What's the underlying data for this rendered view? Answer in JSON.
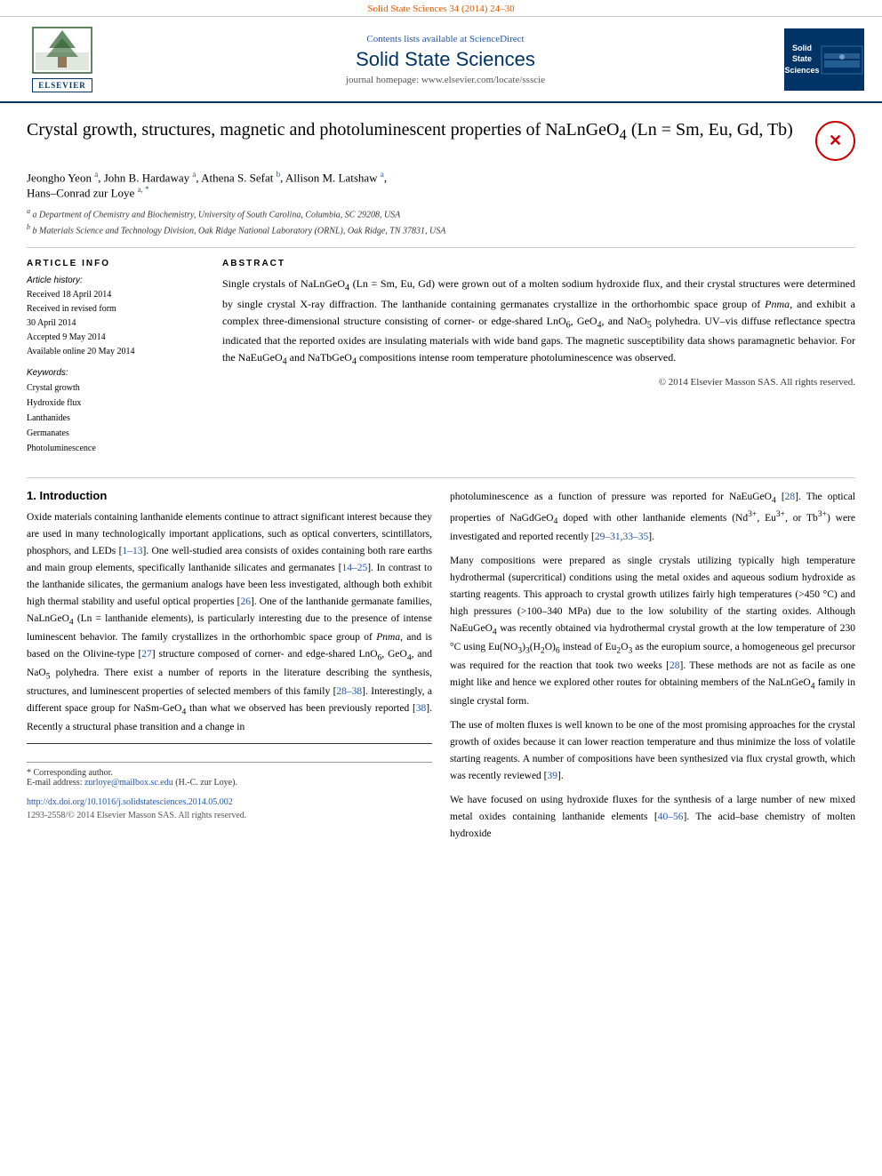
{
  "topbar": {
    "text": "Solid State Sciences 34 (2014) 24–30"
  },
  "header": {
    "contents_text": "Contents lists available at",
    "contents_link": "ScienceDirect",
    "journal_title": "Solid State Sciences",
    "homepage_label": "journal homepage: www.elsevier.com/locate/ssscie",
    "logo_left_label": "ELSEVIER",
    "logo_right_text": "Solid\nState\nSciences"
  },
  "article": {
    "title": "Crystal growth, structures, magnetic and photoluminescent properties of NaLnGeO₄ (Ln = Sm, Eu, Gd, Tb)",
    "authors": "Jeongho Yeon a, John B. Hardaway a, Athena S. Sefat b, Allison M. Latshaw a, Hans–Conrad zur Loye a, *",
    "affiliation_a": "a Department of Chemistry and Biochemistry, University of South Carolina, Columbia, SC 29208, USA",
    "affiliation_b": "b Materials Science and Technology Division, Oak Ridge National Laboratory (ORNL), Oak Ridge, TN 37831, USA"
  },
  "article_info": {
    "heading": "ARTICLE INFO",
    "history_heading": "Article history:",
    "received": "Received 18 April 2014",
    "received_revised": "Received in revised form\n30 April 2014",
    "accepted": "Accepted 9 May 2014",
    "available": "Available online 20 May 2014",
    "keywords_heading": "Keywords:",
    "keywords": [
      "Crystal growth",
      "Hydroxide flux",
      "Lanthanides",
      "Germanates",
      "Photoluminescence"
    ]
  },
  "abstract": {
    "heading": "ABSTRACT",
    "text": "Single crystals of NaLnGeO₄ (Ln = Sm, Eu, Gd) were grown out of a molten sodium hydroxide flux, and their crystal structures were determined by single crystal X-ray diffraction. The lanthanide containing germanates crystallize in the orthorhombic space group of Pnma, and exhibit a complex three-dimensional structure consisting of corner- or edge-shared LnO₆, GeO₄, and NaO₅ polyhedra. UV–vis diffuse reflectance spectra indicated that the reported oxides are insulating materials with wide band gaps. The magnetic susceptibility data shows paramagnetic behavior. For the NaEuGeO₄ and NaTbGeO₄ compositions intense room temperature photoluminescence was observed.",
    "copyright": "© 2014 Elsevier Masson SAS. All rights reserved."
  },
  "intro": {
    "heading": "1. Introduction",
    "paragraph1": "Oxide materials containing lanthanide elements continue to attract significant interest because they are used in many technologically important applications, such as optical converters, scintillators, phosphors, and LEDs [1–13]. One well-studied area consists of oxides containing both rare earths and main group elements, specifically lanthanide silicates and germanates [14–25]. In contrast to the lanthanide silicates, the germanium analogs have been less investigated, although both exhibit high thermal stability and useful optical properties [26]. One of the lanthanide germanate families, NaLnGeO₄ (Ln = lanthanide elements), is particularly interesting due to the presence of intense luminescent behavior. The family crystallizes in the orthorhombic space group of Pnma, and is based on the Olivine-type [27] structure composed of corner- and edge-shared LnO₆, GeO₄, and NaO₅ polyhedra. There exist a number of reports in the literature describing the synthesis, structures, and luminescent properties of selected members of this family [28–38]. Interestingly, a different space group for NaSm-GeO₄ than what we observed has been previously reported [38]. Recently a structural phase transition and a change in",
    "paragraph2_right": "photoluminescence as a function of pressure was reported for NaEuGeO₄ [28]. The optical properties of NaGdGeO₄ doped with other lanthanide elements (Nd³⁺, Eu³⁺, or Tb³⁺) were investigated and reported recently [29–31,33–35].",
    "paragraph3_right": "Many compositions were prepared as single crystals utilizing typically high temperature hydrothermal (supercritical) conditions using the metal oxides and aqueous sodium hydroxide as starting reagents. This approach to crystal growth utilizes fairly high temperatures (>450 °C) and high pressures (>100–340 MPa) due to the low solubility of the starting oxides. Although NaEuGeO₄ was recently obtained via hydrothermal crystal growth at the low temperature of 230 °C using Eu(NO₃)₃(H₂O)₆ instead of Eu₂O₃ as the europium source, a homogeneous gel precursor was required for the reaction that took two weeks [28]. These methods are not as facile as one might like and hence we explored other routes for obtaining members of the NaLnGeO₄ family in single crystal form.",
    "paragraph4_right": "The use of molten fluxes is well known to be one of the most promising approaches for the crystal growth of oxides because it can lower reaction temperature and thus minimize the loss of volatile starting reagents. A number of compositions have been synthesized via flux crystal growth, which was recently reviewed [39].",
    "paragraph5_right": "We have focused on using hydroxide fluxes for the synthesis of a large number of new mixed metal oxides containing lanthanide elements [40–56]. The acid–base chemistry of molten hydroxide"
  },
  "footer": {
    "corresponding_author": "* Corresponding author.",
    "email_label": "E-mail address:",
    "email": "zurloye@mailbox.sc.edu",
    "email_suffix": "(H.-C. zur Loye).",
    "doi": "http://dx.doi.org/10.1016/j.solidstatesciences.2014.05.002",
    "issn": "1293-2558/© 2014 Elsevier Masson SAS. All rights reserved."
  }
}
